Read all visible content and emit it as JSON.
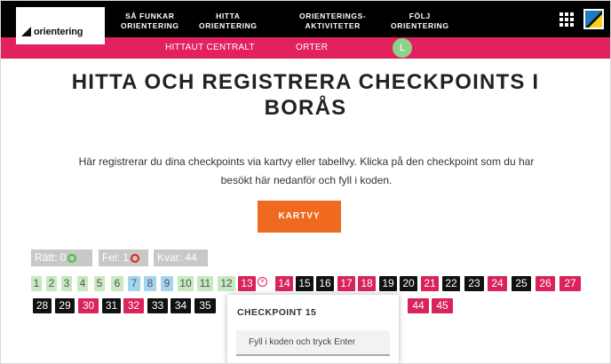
{
  "brand": {
    "logo_text": "orientering"
  },
  "nav": {
    "items": [
      {
        "line1": "SÅ FUNKAR",
        "line2": "ORIENTERING"
      },
      {
        "line1": "HITTA",
        "line2": "ORIENTERING"
      },
      {
        "line1": "ORIENTERINGS-",
        "line2": "AKTIVITETER"
      },
      {
        "line1": "FÖLJ",
        "line2": "ORIENTERING"
      }
    ]
  },
  "subnav": {
    "items": [
      "HITTAUT CENTRALT",
      "ORTER"
    ],
    "avatar_letter": "L"
  },
  "page": {
    "title_line1": "HITTA OCH REGISTRERA CHECKPOINTS I",
    "title_line2": "BORÅS",
    "intro_line1": "Här registrerar du dina checkpoints via kartvy eller tabellvy. Klicka på den checkpoint som du har",
    "intro_line2": "besökt här nedanför och fyll i koden.",
    "kartvy_label": "KARTVY"
  },
  "stats": {
    "ratt": "Rätt: 0",
    "fel": "Fel: 1",
    "kvar": "Kvar: 44"
  },
  "checkpoints": [
    {
      "n": "1",
      "s": "green"
    },
    {
      "n": "2",
      "s": "green"
    },
    {
      "n": "3",
      "s": "green"
    },
    {
      "n": "4",
      "s": "green"
    },
    {
      "n": "5",
      "s": "green"
    },
    {
      "n": "6",
      "s": "green"
    },
    {
      "n": "7",
      "s": "blue"
    },
    {
      "n": "8",
      "s": "blue"
    },
    {
      "n": "9",
      "s": "blue"
    },
    {
      "n": "10",
      "s": "green"
    },
    {
      "n": "11",
      "s": "green"
    },
    {
      "n": "12",
      "s": "green"
    },
    {
      "n": "13",
      "s": "red"
    },
    {
      "n": "14",
      "s": "red"
    },
    {
      "n": "15",
      "s": "black"
    },
    {
      "n": "16",
      "s": "black"
    },
    {
      "n": "17",
      "s": "red"
    },
    {
      "n": "18",
      "s": "red"
    },
    {
      "n": "19",
      "s": "black"
    },
    {
      "n": "20",
      "s": "black"
    },
    {
      "n": "21",
      "s": "red"
    },
    {
      "n": "22",
      "s": "black"
    },
    {
      "n": "23",
      "s": "black"
    },
    {
      "n": "24",
      "s": "red"
    },
    {
      "n": "25",
      "s": "black"
    },
    {
      "n": "26",
      "s": "red"
    },
    {
      "n": "27",
      "s": "red"
    },
    {
      "n": "28",
      "s": "black"
    },
    {
      "n": "29",
      "s": "black"
    },
    {
      "n": "30",
      "s": "red"
    },
    {
      "n": "31",
      "s": "black"
    },
    {
      "n": "32",
      "s": "red"
    },
    {
      "n": "33",
      "s": "black"
    },
    {
      "n": "34",
      "s": "black"
    },
    {
      "n": "35",
      "s": "black"
    },
    {
      "n": "44",
      "s": "red"
    },
    {
      "n": "45",
      "s": "red"
    }
  ],
  "popup": {
    "title": "CHECKPOINT 15",
    "input_placeholder": "Fyll i koden och tryck Enter"
  },
  "colors": {
    "nav_bg": "#000000",
    "accent_pink": "#e2215f",
    "button_orange": "#ef6a1f",
    "found_green": "#c6e9bf",
    "found_blue": "#a3d6ee",
    "error_red": "#d8245a",
    "unfound_black": "#111111"
  },
  "icons": {
    "menu": "grid-menu-icon",
    "flag": "orienteering-flag-icon",
    "correct": "check-circle-icon",
    "wrong": "x-circle-icon"
  }
}
